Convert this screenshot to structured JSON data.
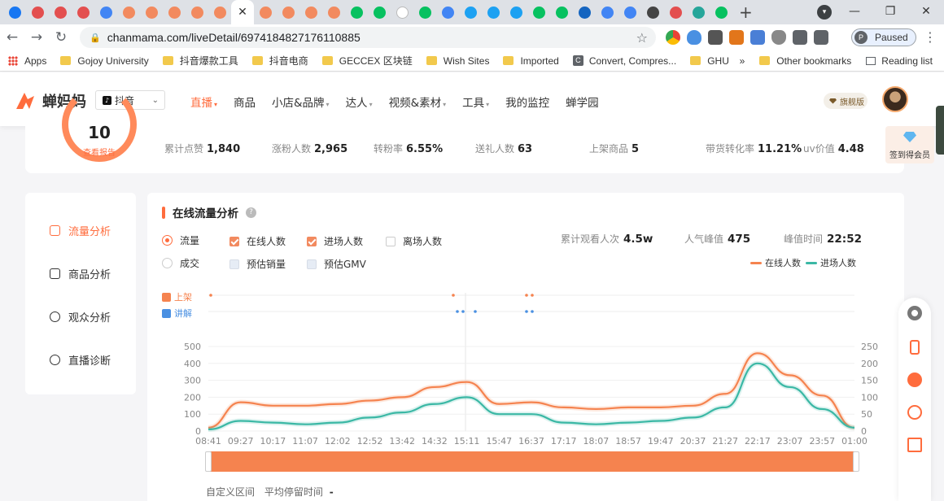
{
  "browser": {
    "tab_count_icons": [
      "facebook-icon",
      "chanmama-icon",
      "chanmama-icon",
      "chanmama-icon",
      "chrome-icon",
      "chanmama-icon",
      "chanmama-icon",
      "chanmama-icon",
      "chanmama-icon",
      "chanmama-icon"
    ],
    "url": "chanmama.com/liveDetail/6974184827176110885",
    "profile_label": "Paused",
    "profile_initial": "P",
    "bookmarks": [
      {
        "label": "Apps",
        "icon": "apps-grid-icon"
      },
      {
        "label": "Gojoy University",
        "icon": "folder-icon"
      },
      {
        "label": "抖音爆款工具",
        "icon": "folder-icon"
      },
      {
        "label": "抖音电商",
        "icon": "folder-icon"
      },
      {
        "label": "GECCEX 区块链",
        "icon": "folder-icon"
      },
      {
        "label": "Wish Sites",
        "icon": "folder-icon"
      },
      {
        "label": "Imported",
        "icon": "folder-icon"
      },
      {
        "label": "Convert, Compres...",
        "icon": "c-icon"
      },
      {
        "label": "GHU",
        "icon": "folder-icon"
      }
    ],
    "bookmarks_more": "»",
    "other_bookmarks": "Other bookmarks",
    "reading_list": "Reading list"
  },
  "site": {
    "logo_text": "蝉妈妈",
    "platform": "抖音",
    "nav": [
      {
        "label": "直播",
        "caret": true,
        "active": true
      },
      {
        "label": "商品",
        "caret": false
      },
      {
        "label": "小店&品牌",
        "caret": true
      },
      {
        "label": "达人",
        "caret": true
      },
      {
        "label": "视频&素材",
        "caret": true
      },
      {
        "label": "工具",
        "caret": true
      },
      {
        "label": "我的监控",
        "caret": false
      },
      {
        "label": "蝉学园",
        "caret": false
      }
    ],
    "vip_label": "旗舰版"
  },
  "stats": {
    "score": "10",
    "score_link": "查看报告",
    "items": [
      {
        "label": "累计点赞",
        "value": "1,840"
      },
      {
        "label": "涨粉人数",
        "value": "2,965"
      },
      {
        "label": "转粉率",
        "value": "6.55%"
      },
      {
        "label": "送礼人数",
        "value": "63"
      },
      {
        "label": "上架商品",
        "value": "5"
      },
      {
        "label": "带货转化率",
        "value": "11.21%"
      },
      {
        "label": "uv价值",
        "value": "4.48"
      }
    ],
    "signin_label": "签到得会员"
  },
  "sidebar": {
    "items": [
      {
        "label": "流量分析",
        "active": true
      },
      {
        "label": "商品分析",
        "active": false
      },
      {
        "label": "观众分析",
        "active": false
      },
      {
        "label": "直播诊断",
        "active": false
      }
    ]
  },
  "panel": {
    "title": "在线流量分析",
    "help": "?",
    "radios": [
      {
        "label": "流量",
        "checked": true
      },
      {
        "label": "成交",
        "checked": false
      }
    ],
    "checkboxes": [
      {
        "label": "在线人数",
        "checked": true
      },
      {
        "label": "进场人数",
        "checked": true
      },
      {
        "label": "离场人数",
        "checked": false
      },
      {
        "label": "预估销量",
        "checked": false
      },
      {
        "label": "预估GMV",
        "checked": false
      }
    ],
    "metrics": [
      {
        "label": "累计观看人次",
        "value": "4.5w"
      },
      {
        "label": "人气峰值",
        "value": "475"
      },
      {
        "label": "峰值时间",
        "value": "22:52"
      }
    ],
    "marker_labels": {
      "listing": "上架",
      "explain": "讲解"
    },
    "footer_custom": "自定义区间",
    "footer_avg_label": "平均停留时间",
    "footer_avg_value": "-"
  },
  "colors": {
    "accent": "#ff6c3d",
    "online": "#f5834f",
    "entering": "#3bb8a5"
  },
  "chart_data": {
    "type": "line",
    "x": [
      "08:41",
      "09:27",
      "10:17",
      "11:07",
      "12:02",
      "12:52",
      "13:42",
      "14:32",
      "15:11",
      "15:47",
      "16:37",
      "17:17",
      "18:07",
      "18:57",
      "19:47",
      "20:37",
      "21:27",
      "22:17",
      "23:07",
      "23:57",
      "01:00"
    ],
    "series": [
      {
        "name": "在线人数",
        "axis": "left",
        "color": "#f5834f",
        "values": [
          20,
          170,
          150,
          150,
          160,
          180,
          200,
          260,
          290,
          160,
          170,
          140,
          130,
          140,
          140,
          150,
          220,
          460,
          330,
          210,
          20
        ]
      },
      {
        "name": "进场人数",
        "axis": "right",
        "color": "#3bb8a5",
        "values": [
          5,
          30,
          25,
          20,
          25,
          40,
          55,
          80,
          100,
          50,
          50,
          25,
          20,
          25,
          30,
          40,
          70,
          200,
          130,
          65,
          10
        ]
      }
    ],
    "ylim_left": [
      0,
      500
    ],
    "yticks_left": [
      0,
      100,
      200,
      300,
      400,
      500
    ],
    "ylim_right": [
      0,
      250
    ],
    "yticks_right": [
      0,
      50,
      100,
      150,
      200,
      250
    ],
    "legend": "top-right",
    "grid": true
  }
}
